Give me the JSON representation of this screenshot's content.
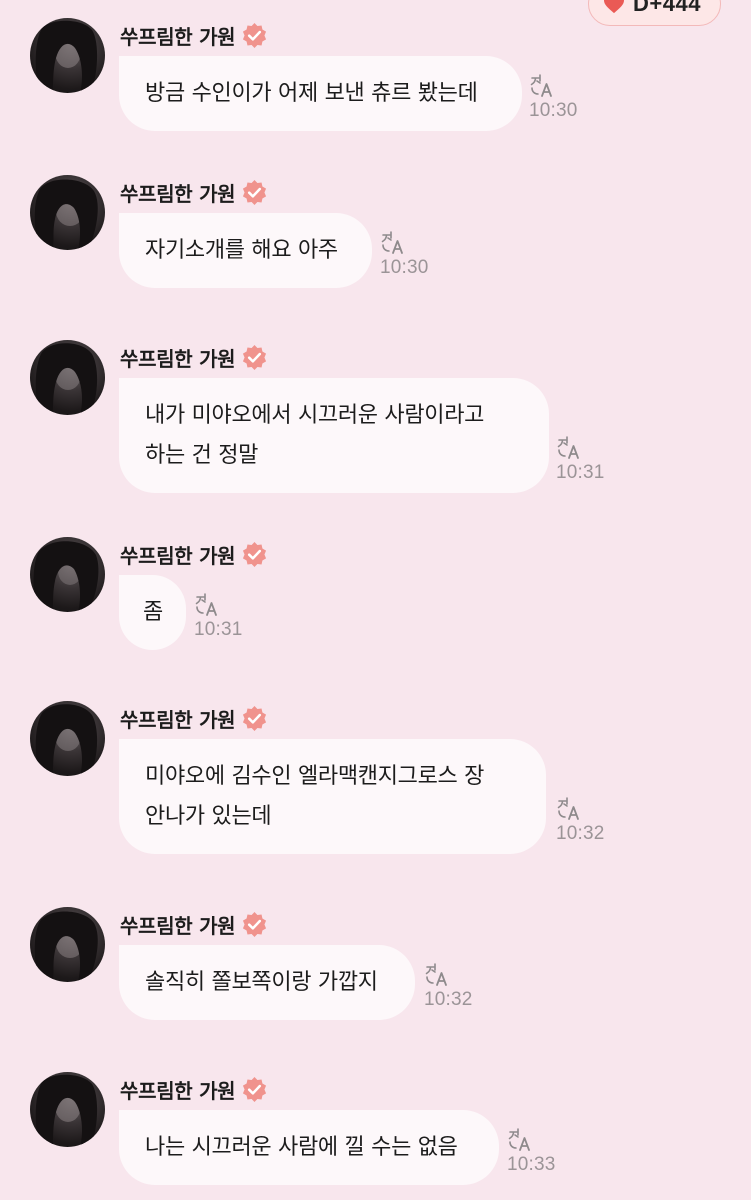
{
  "dday_badge": {
    "label": "D+444",
    "icon": "heart-icon",
    "heart_color": "#ea5a55"
  },
  "colors": {
    "background": "#f8e6ed",
    "bubble": "#fdf8fa",
    "verified_badge": "#f0938d",
    "timestamp": "#9b9497"
  },
  "messages": [
    {
      "sender": "쑤프림한 가원",
      "lines": [
        "방금 수인이가 어제 보낸 츄르 봤는데"
      ],
      "time": "10:30"
    },
    {
      "sender": "쑤프림한 가원",
      "lines": [
        "자기소개를 해요 아주"
      ],
      "time": "10:30"
    },
    {
      "sender": "쑤프림한 가원",
      "lines": [
        "내가 미야오에서 시끄러운 사람이라고",
        "하는 건 정말"
      ],
      "time": "10:31"
    },
    {
      "sender": "쑤프림한 가원",
      "lines": [
        "좀"
      ],
      "time": "10:31"
    },
    {
      "sender": "쑤프림한 가원",
      "lines": [
        "미야오에 김수인 엘라맥캔지그로스 장",
        "안나가 있는데"
      ],
      "time": "10:32"
    },
    {
      "sender": "쑤프림한 가원",
      "lines": [
        "솔직히 쫄보쪽이랑 가깝지"
      ],
      "time": "10:32"
    },
    {
      "sender": "쑤프림한 가원",
      "lines": [
        "나는 시끄러운 사람에 낄 수는 없음"
      ],
      "time": "10:33"
    }
  ]
}
